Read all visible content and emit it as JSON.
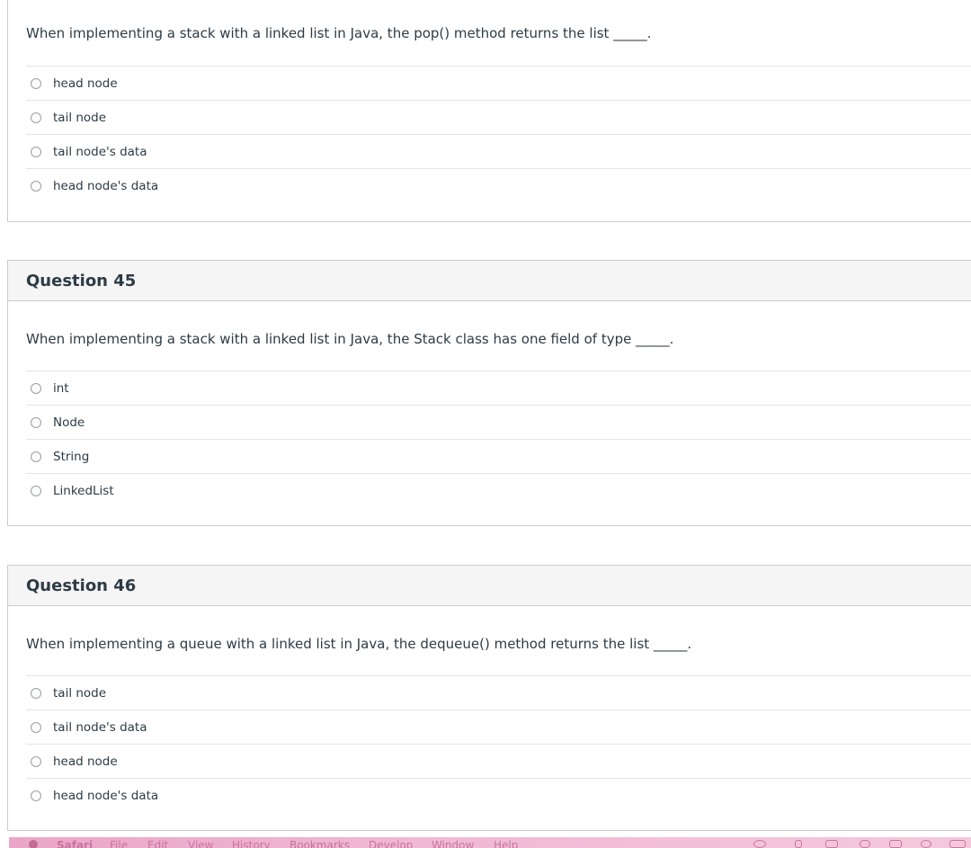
{
  "question_44": {
    "prompt": "When implementing a stack with a linked list in Java, the pop() method returns the list _____.",
    "answers": [
      "head node",
      "tail node",
      "tail node's data",
      "head node's data"
    ]
  },
  "question_45": {
    "title": "Question 45",
    "prompt": "When implementing a stack with a linked list in Java, the Stack class has one field of type _____.",
    "answers": [
      "int",
      "Node",
      "String",
      "LinkedList"
    ]
  },
  "question_46": {
    "title": "Question 46",
    "prompt": "When implementing a queue with a linked list in Java, the dequeue() method returns the list _____.",
    "answers": [
      "tail node",
      "tail node's data",
      "head node",
      "head node's data"
    ]
  },
  "menubar": {
    "items": [
      "Safari",
      "File",
      "Edit",
      "View",
      "History",
      "Bookmarks",
      "Develop",
      "Window",
      "Help"
    ],
    "icons": [
      "creative-cloud-icon",
      "usb-icon",
      "photo-icon",
      "evernote-icon",
      "calendar-icon",
      "play-icon",
      "volume-icon"
    ]
  }
}
